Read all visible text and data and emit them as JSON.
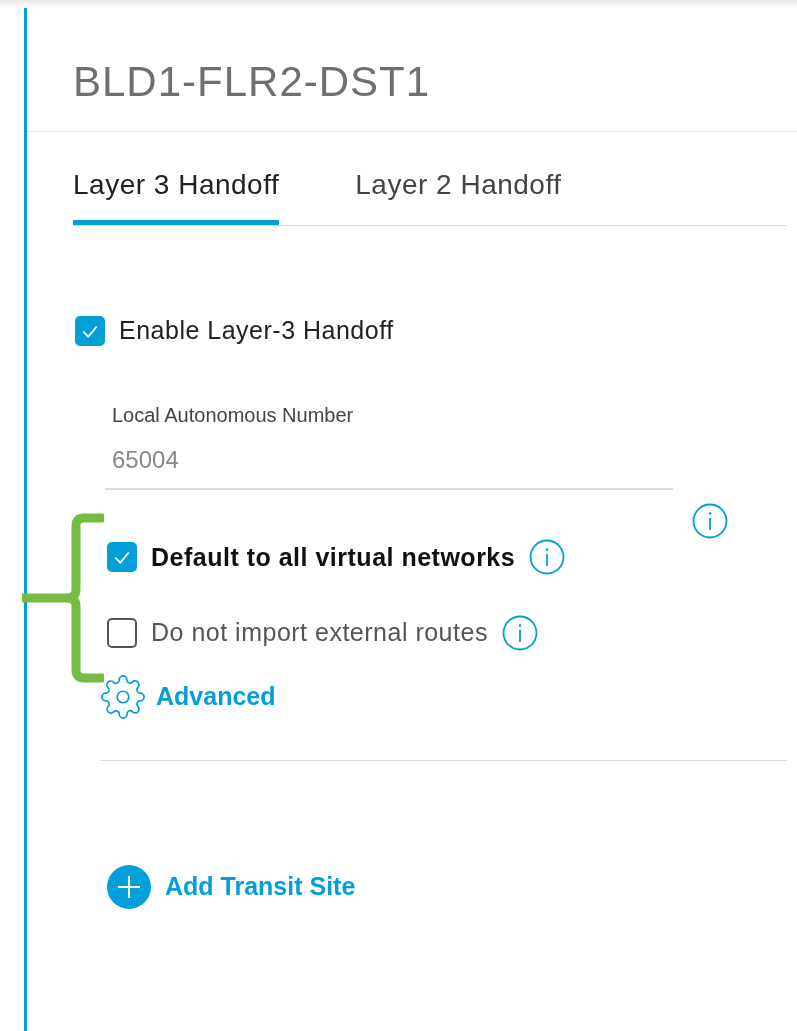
{
  "title": "BLD1-FLR2-DST1",
  "tabs": [
    {
      "label": "Layer 3 Handoff",
      "selected": true
    },
    {
      "label": "Layer 2 Handoff",
      "selected": false
    }
  ],
  "enable": {
    "label": "Enable Layer-3 Handoff",
    "checked": true
  },
  "field": {
    "label": "Local Autonomous Number",
    "value": "65004"
  },
  "options": [
    {
      "label": "Default to all virtual networks",
      "checked": true
    },
    {
      "label": "Do not import external routes",
      "checked": false
    }
  ],
  "advanced": "Advanced",
  "add_transit": "Add Transit Site"
}
